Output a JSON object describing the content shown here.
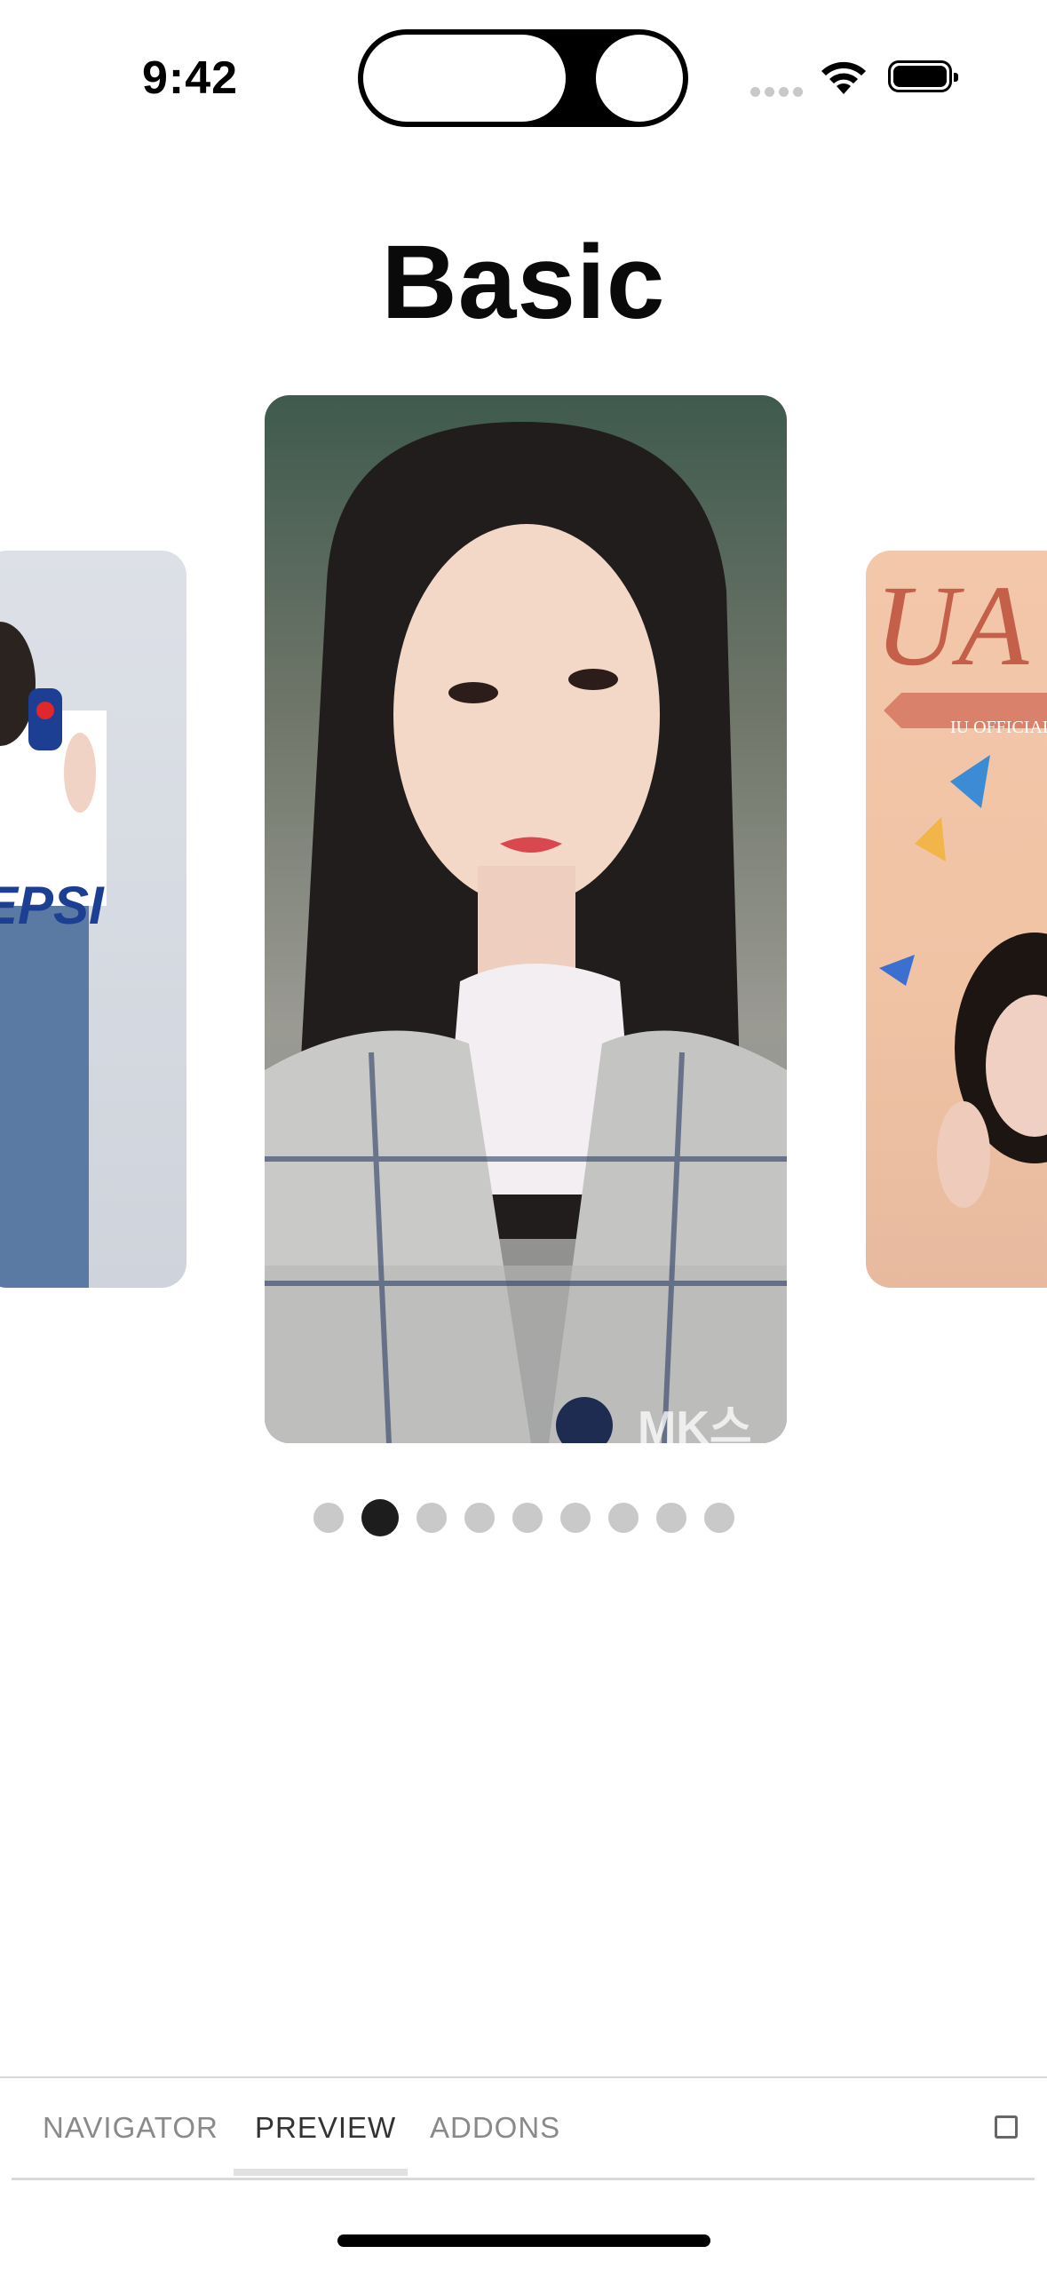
{
  "status_bar": {
    "time": "9:42"
  },
  "page": {
    "title": "Basic"
  },
  "carousel": {
    "total": 9,
    "active_index": 1,
    "cards": [
      {
        "name": "card-left",
        "text": "EPSI"
      },
      {
        "name": "card-center",
        "text": "MK스"
      },
      {
        "name": "card-right",
        "text": "UA",
        "banner": "IU OFFICIAL"
      }
    ]
  },
  "bottom_tabs": {
    "items": [
      {
        "label": "NAVIGATOR"
      },
      {
        "label": "PREVIEW"
      },
      {
        "label": "ADDONS"
      }
    ],
    "active": "PREVIEW"
  },
  "colors": {
    "dot_active": "#1d1d1d",
    "dot_inactive": "#c9c9c9",
    "tab_text": "#8a8a8a",
    "tab_active_text": "#333333"
  }
}
